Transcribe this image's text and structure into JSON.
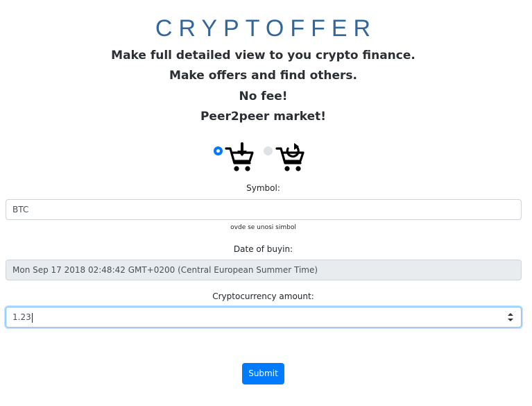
{
  "header": {
    "brand": "CRYPTOFFER",
    "taglines": [
      "Make full detailed view to you crypto finance.",
      "Make offers and find others.",
      "No fee!",
      "Peer2peer market!"
    ]
  },
  "offer_type": {
    "options": [
      {
        "icon": "cart-download-icon",
        "selected": true
      },
      {
        "icon": "cart-refresh-icon",
        "selected": false
      }
    ]
  },
  "form": {
    "symbol": {
      "label": "Symbol:",
      "value": "BTC",
      "hint": "ovde se unosi simbol"
    },
    "date": {
      "label": "Date of buyin:",
      "value": "Mon Sep 17 2018 02:48:42 GMT+0200 (Central European Summer Time)"
    },
    "amount": {
      "label": "Cryptocurrency amount:",
      "value": "1.23"
    },
    "submit_label": "Submit"
  },
  "colors": {
    "brand": "#336699",
    "primary": "#007bff"
  }
}
